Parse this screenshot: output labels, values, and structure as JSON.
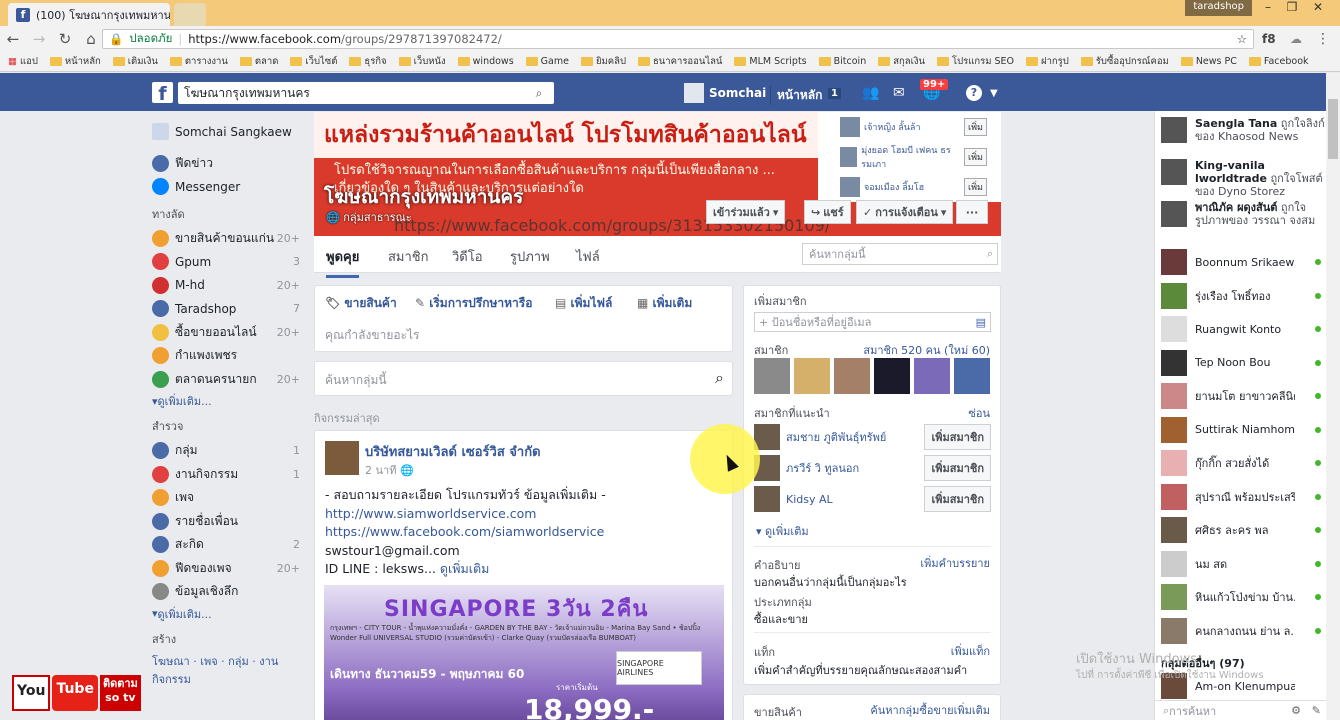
{
  "browser": {
    "tab_title": "(100) โฆษณากรุงเทพมหานคร",
    "tab_favicon": "f",
    "profile": "taradshop",
    "secure_label": "ปลอดภัย",
    "url_host": "https://www.facebook.com",
    "url_path": "/groups/297871397082472/",
    "bookmarks": [
      "แอป",
      "หน้าหลัก",
      "เติมเงิน",
      "ตารางงาน",
      "ตลาด",
      "เว็บไซต์",
      "ธุรกิจ",
      "เว็บหนัง",
      "windows",
      "Game",
      "ยิมคลิป",
      "ธนาคารออนไลน์",
      "MLM Scripts",
      "Bitcoin",
      "สกุลเงิน",
      "โปรแกรม SEO",
      "ฝากรูป",
      "รับซื้ออุปกรณ์คอม",
      "News PC",
      "Facebook"
    ]
  },
  "fb": {
    "search_value": "โฆษณากรุงเทพมหานคร",
    "user_short": "Somchai",
    "home": "หน้าหลัก",
    "home_count": "1",
    "notif_count": "99+"
  },
  "leftnav": {
    "profile": "Somchai Sangkaew",
    "top": [
      {
        "label": "ฟีดข่าว"
      },
      {
        "label": "Messenger"
      }
    ],
    "shortcuts_header": "ทางลัด",
    "shortcuts": [
      {
        "label": "ขายสินค้าขอนแก่น",
        "count": "20+"
      },
      {
        "label": "Gpum",
        "count": "3"
      },
      {
        "label": "M-hd",
        "count": "20+"
      },
      {
        "label": "Taradshop",
        "count": "7"
      },
      {
        "label": "ซื้อขายออนไลน์",
        "count": "20+"
      },
      {
        "label": "กำแพงเพชร",
        "count": ""
      },
      {
        "label": "ตลาดนครนายก",
        "count": "20+"
      }
    ],
    "more1": "ดูเพิ่มเติม...",
    "explore_header": "สำรวจ",
    "explore": [
      {
        "label": "กลุ่ม",
        "count": "1"
      },
      {
        "label": "งานกิจกรรม",
        "count": "1"
      },
      {
        "label": "เพจ",
        "count": ""
      },
      {
        "label": "รายชื่อเพื่อน",
        "count": ""
      },
      {
        "label": "สะกิด",
        "count": "2"
      },
      {
        "label": "ฟีดของเพจ",
        "count": "20+"
      },
      {
        "label": "ข้อมูลเชิงลึก",
        "count": ""
      }
    ],
    "more2": "ดูเพิ่มเติม...",
    "create_header": "สร้าง",
    "create_links": "โฆษณา · เพจ · กลุ่ม · งานกิจกรรม"
  },
  "cover": {
    "banner": "แหล่งรวมร้านค้าออนไลน์ โปรโมทสินค้าออนไลน์",
    "text": "โปรดใช้วิจารณญาณในการเลือกซื้อสินค้าและบริการ กลุ่มนี้เป็นเพียงสื่อกลาง ... เกี่ยวข้องใด ๆ ในสินค้าและบริการแต่อย่างใด",
    "url": "https://www.facebook.com/groups/313153302150109/",
    "group_title": "โฆษณากรุงเทพมหานคร",
    "group_type": "กลุ่มสาธารณะ",
    "panel": [
      {
        "name": "เจ้าหญิง ลั้นล้า",
        "btn": "เพิ่ม"
      },
      {
        "name": "มุ่งยอด โฮมบี เฟคน ธรรมเภา",
        "btn": "เพิ่ม"
      },
      {
        "name": "จอมเมือง ลิ้มโฮ",
        "btn": "เพิ่ม"
      }
    ],
    "joined_btn": "เข้าร่วมแล้ว",
    "share_btn": "แชร์",
    "notify_btn": "การแจ้งเตือน",
    "more_btn": "···"
  },
  "tabs": [
    "พูดคุย",
    "สมาชิก",
    "วิดีโอ",
    "รูปภาพ",
    "ไฟล์"
  ],
  "group_search_ph": "ค้นหากลุ่มนี้",
  "composer": {
    "tabs": [
      "ขายสินค้า",
      "เริ่มการปรึกษาหารือ",
      "เพิ่มไฟล์",
      "เพิ่มเติม"
    ],
    "placeholder": "คุณกำลังขายอะไร"
  },
  "search_group_ph": "ค้นหากลุ่มนี้",
  "recent_label": "กิจกรรมล่าสุด",
  "post": {
    "author": "บริษัทสยามเวิลด์ เซอร์วิส จำกัด",
    "time": "2 นาที",
    "line1": "- สอบถามรายละเอียด โปรแกรมทัวร์ ข้อมูลเพิ่มเติม -",
    "link1": "http://www.siamworldservice.com",
    "link2": "https://www.facebook.com/siamworldservice",
    "line4": "swstour1@gmail.com",
    "line5": "ID LINE : leksws...",
    "see_more": "ดูเพิ่มเติม",
    "img_title": "SINGAPORE 3วัน 2คืน",
    "img_sub": "กรุงเทพฯ - CITY TOUR - น้ำพุแห่งความมั่งคั่ง - GARDEN BY THE BAY - วัดเจ้าแม่กวนอิม - Marina Bay Sand • ช้อปปิ้ง Wonder Full UNIVERSAL STUDIO (รวมค่าบัตรเข้า) - Clarke Quay (รวมบัตรล่องเรือ BUMBOAT)",
    "img_date": "เดินทาง ธันวาคม59 - พฤษภาคม 60",
    "img_from": "ราคาเริ่มต้น",
    "img_price": "18,999.-",
    "img_airline": "SINGAPORE AIRLINES"
  },
  "right": {
    "add_member_label": "เพิ่มสมาชิก",
    "add_member_ph": "+ ป้อนชื่อหรือที่อยู่อีเมล",
    "members_label": "สมาชิก",
    "members_count": "สมาชิก 520 คน (ใหม่ 60)",
    "suggested_label": "สมาชิกที่แนะนำ",
    "hide": "ซ่อน",
    "suggested": [
      {
        "name": "สมชาย ภูติพันธุ์ทรัพย์",
        "btn": "เพิ่มสมาชิก"
      },
      {
        "name": "ภรวีร์ วิ ทูลนอก",
        "btn": "เพิ่มสมาชิก"
      },
      {
        "name": "Kidsy AL",
        "btn": "เพิ่มสมาชิก"
      }
    ],
    "see_more": "ดูเพิ่มเติม",
    "desc_label": "คำอธิบาย",
    "desc_add": "เพิ่มคำบรรยาย",
    "desc_text": "บอกคนอื่นว่ากลุ่มนี้เป็นกลุ่มอะไร",
    "type_label": "ประเภทกลุ่ม",
    "type_value": "ซื้อและขาย",
    "tags_label": "แท็ก",
    "tags_add": "เพิ่มแท็ก",
    "tags_text": "เพิ่มคำสำคัญที่บรรยายคุณลักษณะสองสามคำ",
    "sell_label": "ขายสินค้า",
    "sell_link": "ค้นหากลุ่มซื้อขายเพิ่มเติม"
  },
  "chat": {
    "ticker": [
      {
        "name": "Saengla Tana",
        "text": "ถูกใจลิงก์ของ Khaosod News"
      },
      {
        "name": "King-vanila lworldtrade",
        "text": "ถูกใจโพสต์ของ Dyno Storez"
      },
      {
        "name": "พาณิภัค ผดุงสันต์",
        "text": "ถูกใจรูปภาพของ วรรณา จงสม"
      }
    ],
    "contacts": [
      "Boonnum Srikaew",
      "รุ่งเรือง โพธิ์ทอง",
      "Ruangwit Konto",
      "Tep Noon Bou",
      "ยานมโต ยาขาวคลีนิค",
      "Suttirak Niamhom",
      "กุ๊กกิ๊ก สวยสั่งได้",
      "สุปราณี พร้อมประเสริฐ",
      "ศศิธร ละคร พล",
      "นม สด",
      "หินแก้วโป่งข่าม บ้าน...",
      "คนกลางถนน ย่าน ล..."
    ],
    "groups_label": "กลุ่มต่ออื่นๆ (97)",
    "last": "Am-on Klenumpuay",
    "search_ph": "การค้นหา"
  },
  "watermark": {
    "line1": "เปิดใช้งาน Windows",
    "line2": "ไปที่ การตั้งค่าพีซี เพื่อเปิดใช้งาน Windows"
  },
  "channel": {
    "you": "You",
    "tube": "Tube",
    "name1": "ติดตาม",
    "name2": "so tv"
  }
}
